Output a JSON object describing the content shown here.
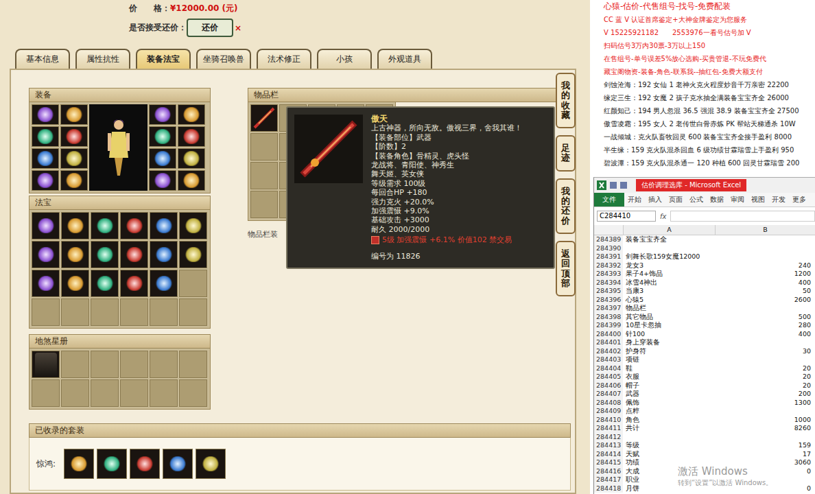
{
  "listing": {
    "price_label": "价　　格：",
    "price": "¥12000.00 (元)",
    "bargain_label": "是否接受还价：",
    "bargain_button": "还价",
    "bargain_mark": "×"
  },
  "tabs": [
    {
      "label": "基本信息",
      "selected": false
    },
    {
      "label": "属性抗性",
      "selected": false
    },
    {
      "label": "装备法宝",
      "selected": true
    },
    {
      "label": "坐骑召唤兽",
      "selected": false
    },
    {
      "label": "法术修正",
      "selected": false
    },
    {
      "label": "小孩",
      "selected": false
    },
    {
      "label": "外观道具",
      "selected": false
    }
  ],
  "equipment": {
    "title": "装备",
    "left_slots": [
      {
        "filled": true
      },
      {
        "filled": true
      },
      {
        "filled": true
      },
      {
        "filled": true
      },
      {
        "filled": true
      },
      {
        "filled": true
      },
      {
        "filled": true
      },
      {
        "filled": true
      }
    ],
    "right_slots": [
      {
        "filled": true
      },
      {
        "filled": true
      },
      {
        "filled": true
      },
      {
        "filled": true
      },
      {
        "filled": true
      },
      {
        "filled": true
      },
      {
        "filled": true
      },
      {
        "filled": true
      }
    ]
  },
  "treasures": {
    "title": "法宝",
    "slots": [
      {
        "filled": true
      },
      {
        "filled": true
      },
      {
        "filled": true
      },
      {
        "filled": true
      },
      {
        "filled": true
      },
      {
        "filled": true
      },
      {
        "filled": true
      },
      {
        "filled": true
      },
      {
        "filled": true
      },
      {
        "filled": true
      },
      {
        "filled": true
      },
      {
        "filled": true
      },
      {
        "filled": true
      },
      {
        "filled": true
      },
      {
        "filled": true
      },
      {
        "filled": true
      },
      {
        "filled": true
      },
      {
        "filled": false
      },
      {
        "filled": false
      },
      {
        "filled": false
      },
      {
        "filled": false
      },
      {
        "filled": false
      },
      {
        "filled": false
      },
      {
        "filled": false
      }
    ]
  },
  "star_book": {
    "title": "地煞星册",
    "slots": [
      {
        "filled": true
      },
      {
        "filled": false
      },
      {
        "filled": false
      },
      {
        "filled": false
      },
      {
        "filled": false
      },
      {
        "filled": false
      },
      {
        "filled": false
      },
      {
        "filled": false
      },
      {
        "filled": false
      },
      {
        "filled": false
      },
      {
        "filled": false
      },
      {
        "filled": false
      }
    ]
  },
  "inventory": {
    "title": "物品栏",
    "note": "物品栏装",
    "slots": [
      {
        "filled": true
      },
      {
        "filled": false
      },
      {
        "filled": false
      },
      {
        "filled": false
      },
      {
        "filled": false
      },
      {
        "filled": false
      },
      {
        "filled": false
      },
      {
        "filled": false
      },
      {
        "filled": false
      },
      {
        "filled": false
      },
      {
        "filled": false
      },
      {
        "filled": false
      },
      {
        "filled": false
      },
      {
        "filled": false
      },
      {
        "filled": false
      },
      {
        "filled": false
      },
      {
        "filled": false
      },
      {
        "filled": false
      },
      {
        "filled": false
      },
      {
        "filled": false
      }
    ]
  },
  "tooltip": {
    "name": "傲天",
    "lines": [
      "上古神器，所向无敌。傲视三界，舍我其谁！",
      "【装备部位】武器",
      "【阶数】2",
      "【装备角色】骨精灵、虎头怪",
      "龙战将、青阳使、神秀生",
      "舞天姬、英女侠",
      "等级需求 100级",
      "每回合HP +180",
      "强力克火 +20.0%",
      "加强震慑 +9.0%",
      "基础攻击 +3000",
      "耐久 2000/2000"
    ],
    "extra": "5级 加强震慑 +6.1% 价值102 禁交易",
    "serial": "编号为 11826"
  },
  "side_nav": [
    "我的收藏",
    "足迹",
    "我的还价",
    "返回顶部"
  ],
  "sets": {
    "title": "已收录的套装",
    "name": "惊鸿:",
    "pieces": [
      {
        "filled": true
      },
      {
        "filled": true
      },
      {
        "filled": true
      },
      {
        "filled": true
      },
      {
        "filled": true
      }
    ]
  },
  "ads": [
    {
      "text": "心猿-估价-代售组号-找号-免费配装",
      "kind": "headline"
    },
    {
      "text": "CC 蓝 V 认证首席鉴定+大神金牌鉴定为您服务",
      "kind": "promo"
    },
    {
      "text": "V 15225921182　　2553976一看号估号加 V",
      "kind": "promo"
    },
    {
      "text": "扫码估号3万内30票-3万以上150",
      "kind": "promo"
    },
    {
      "text": "在售组号-单号误差5%放心选购-买贵管退-不玩免费代",
      "kind": "promo"
    },
    {
      "text": "藏宝阁物资-装备-角色-联系我--抽红包-免费大额支付",
      "kind": "promo"
    },
    {
      "text": "剑蚀沧海：192 女仙 1 老神火克火程度炒音千万亲密 22200",
      "kind": "listing"
    },
    {
      "text": "缘定三生：192 女魔 2 孩子克水抽全满装备宝宝齐全 26000",
      "kind": "listing"
    },
    {
      "text": "红颜知己：194 男人忽混 36.5 强混 38.9 装备宝宝齐全 27500",
      "kind": "listing"
    },
    {
      "text": "傲雪凌霜：195 女人 2 老传世白骨赤炼 PK 帮站天梯通杀 10W",
      "kind": "listing"
    },
    {
      "text": "一战倾城：克火队畜牧回灵 600 装备宝宝齐全接手盈利 8000",
      "kind": "listing"
    },
    {
      "text": "半生缘：159 克火队混杀回血 6 级功绩甘霖瑞雪上手盈利 950",
      "kind": "listing"
    },
    {
      "text": "碧波潭：159 克火队混杀通一 120 种植 600 回灵甘霖瑞雪 200",
      "kind": "listing"
    }
  ],
  "excel": {
    "title": "估价调理选库 - Microsoft Excel",
    "file_tab": "文件",
    "ribbon": [
      "开始",
      "插入",
      "页面",
      "公式",
      "数据",
      "审阅",
      "视图",
      "开发",
      "更多"
    ],
    "name_box": "C284410",
    "fx": "fx",
    "columns": [
      "A",
      "B"
    ],
    "rows": [
      {
        "n": "284389",
        "a": "装备宝宝齐全",
        "b": ""
      },
      {
        "n": "284390",
        "a": "",
        "b": ""
      },
      {
        "n": "284391",
        "a": "剑舞长歌159女魔12000",
        "b": ""
      },
      {
        "n": "284392",
        "a": "龙女3",
        "b": "240"
      },
      {
        "n": "284393",
        "a": "果子4+饰品",
        "b": "1200"
      },
      {
        "n": "284394",
        "a": "冰雪4神出",
        "b": "400"
      },
      {
        "n": "284395",
        "a": "当康3",
        "b": "50"
      },
      {
        "n": "284396",
        "a": "心猿5",
        "b": "2600"
      },
      {
        "n": "284397",
        "a": "物品栏",
        "b": ""
      },
      {
        "n": "284398",
        "a": "其它物品",
        "b": "500"
      },
      {
        "n": "284399",
        "a": "10星卡忽抽",
        "b": "280"
      },
      {
        "n": "284400",
        "a": "针100",
        "b": "400"
      },
      {
        "n": "284401",
        "a": "身上穿装备",
        "b": ""
      },
      {
        "n": "284402",
        "a": "护身符",
        "b": "30"
      },
      {
        "n": "284403",
        "a": "项链",
        "b": ""
      },
      {
        "n": "284404",
        "a": "鞋",
        "b": "20"
      },
      {
        "n": "284405",
        "a": "衣服",
        "b": "20"
      },
      {
        "n": "284406",
        "a": "帽子",
        "b": "20"
      },
      {
        "n": "284407",
        "a": "武器",
        "b": "200"
      },
      {
        "n": "284408",
        "a": "佩饰",
        "b": "1300"
      },
      {
        "n": "284409",
        "a": "点粹",
        "b": ""
      },
      {
        "n": "284410",
        "a": "角色",
        "b": "1000"
      },
      {
        "n": "284411",
        "a": "共计",
        "b": "8260"
      },
      {
        "n": "284412",
        "a": "",
        "b": ""
      },
      {
        "n": "284413",
        "a": "等级",
        "b": "159"
      },
      {
        "n": "284414",
        "a": "天赋",
        "b": "17"
      },
      {
        "n": "284415",
        "a": "功绩",
        "b": "3060"
      },
      {
        "n": "284416",
        "a": "大成",
        "b": "0"
      },
      {
        "n": "284417",
        "a": "职业",
        "b": ""
      },
      {
        "n": "284418",
        "a": "月饼",
        "b": "0"
      }
    ]
  },
  "watermark": [
    "激活 Windows",
    "转到“设置”以激活 Windows。"
  ]
}
